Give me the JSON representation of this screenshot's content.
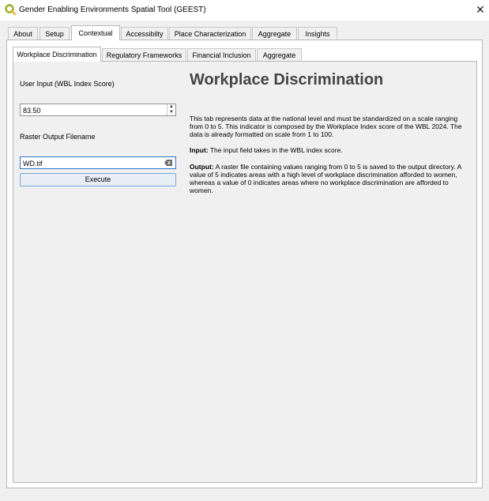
{
  "window": {
    "title": "Gender Enabling Environments Spatial Tool (GEEST)",
    "close_glyph": "✕"
  },
  "main_tabs": [
    {
      "label": "About"
    },
    {
      "label": "Setup"
    },
    {
      "label": "Contextual",
      "active": true
    },
    {
      "label": "Accessibilty"
    },
    {
      "label": "Place Characterization"
    },
    {
      "label": "Aggregate"
    },
    {
      "label": "Insights"
    }
  ],
  "sub_tabs": [
    {
      "label": "Workplace Discrimination",
      "active": true
    },
    {
      "label": "Regulatory Frameworks"
    },
    {
      "label": "Financial Inclusion"
    },
    {
      "label": "Aggregate"
    }
  ],
  "form": {
    "user_input_label": "User Input (WBL Index Score)",
    "score_value": "83.50",
    "raster_label": "Raster Output Filename",
    "filename_value": "WD.tif",
    "execute_label": "Execute"
  },
  "help": {
    "title": "Workplace Discrimination",
    "intro": "This tab represents data at the national level and must be standardized on a scale ranging from 0 to 5. This indicator is composed by the Workplace Index score of the WBL 2024. The data is already formatted on scale from 1 to 100.",
    "input_heading": "Input:",
    "input_text": " The input field takes in the WBL index score.",
    "output_heading": "Output:",
    "output_text": "  A raster file containing values ranging from 0 to 5 is saved to the output directory. A value of 5 indicates areas with a high level of workplace discrimination afforded to women, whereas a value of 0 indicates areas where no workplace discrimination are afforded to women."
  },
  "icons": {
    "app": "qgis-logo-icon",
    "clear": "clear-text-icon",
    "spin_up": "▲",
    "spin_down": "▼"
  }
}
